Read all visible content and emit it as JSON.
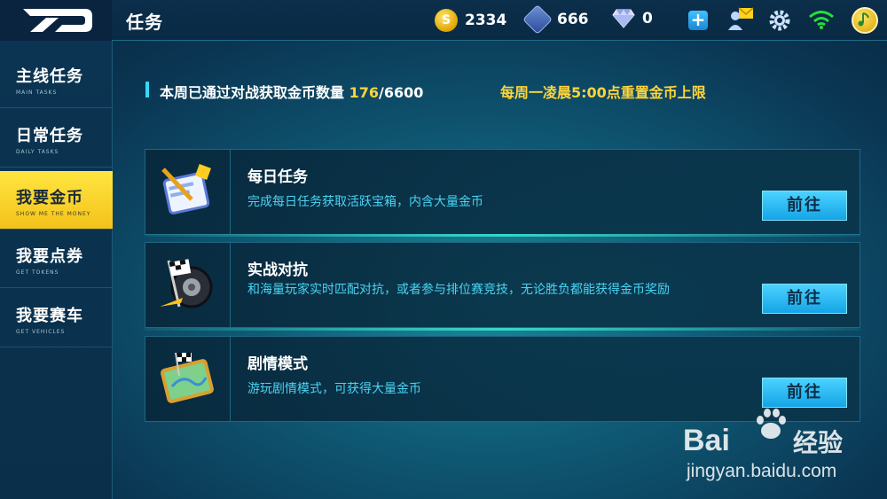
{
  "header": {
    "title": "任务",
    "resources": {
      "coins": "2334",
      "tokens": "666",
      "gems": "0"
    },
    "coin_icon_glyph": "S"
  },
  "sidebar": {
    "items": [
      {
        "label": "主线任务",
        "sub": "MAIN TASKS"
      },
      {
        "label": "日常任务",
        "sub": "DAILY TASKS"
      },
      {
        "label": "我要金币",
        "sub": "SHOW ME THE MONEY",
        "active": true
      },
      {
        "label": "我要点券",
        "sub": "GET TOKENS"
      },
      {
        "label": "我要赛车",
        "sub": "GET VEHICLES"
      }
    ]
  },
  "info": {
    "prefix": "本周已通过对战获取金币数量 ",
    "current": "176",
    "total": "/6600",
    "reset_note": "每周一凌晨5:00点重置金币上限"
  },
  "cards": [
    {
      "name": "每日任务",
      "desc": "完成每日任务获取活跃宝箱，内含大量金币",
      "button": "前往"
    },
    {
      "name": "实战对抗",
      "desc": "和海量玩家实时匹配对抗，或者参与排位赛竞技，无论胜负都能获得金币奖励",
      "button": "前往"
    },
    {
      "name": "剧情模式",
      "desc": "游玩剧情模式，可获得大量金币",
      "button": "前往"
    }
  ],
  "watermark": {
    "brand_left": "Bai",
    "brand_right": "经验",
    "url": "jingyan.baidu.com"
  },
  "colors": {
    "accent_yellow": "#ffd53a",
    "accent_cyan": "#4ad4f2",
    "button_blue": "#14a4e6"
  }
}
